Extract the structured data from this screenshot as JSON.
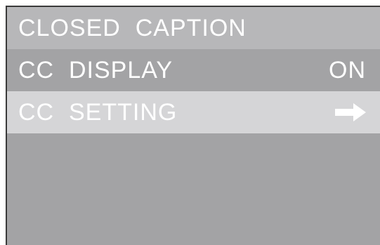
{
  "menu": {
    "title": "CLOSED  CAPTION",
    "items": [
      {
        "label": "CC  DISPLAY",
        "value": "ON"
      },
      {
        "label": "CC  SETTING",
        "icon": "arrow-right-icon"
      }
    ]
  },
  "colors": {
    "panel": "#a3a3a5",
    "title_bar": "#b7b7b9",
    "highlight": "#d5d5d7",
    "text": "#ffffff"
  }
}
